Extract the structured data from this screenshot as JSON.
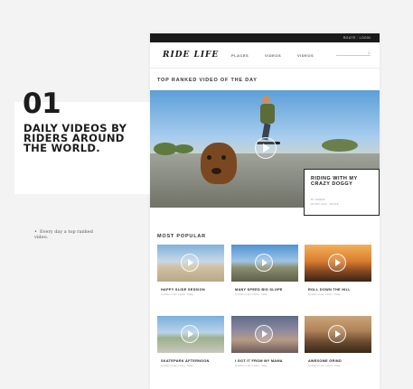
{
  "promo": {
    "number": "01",
    "tagline": "Daily videos by riders around the world.",
    "note": "Every day a top ranked video."
  },
  "site": {
    "topbar_links": "ROUTE · LOGIN",
    "logo": "RIDE LIFE",
    "nav": [
      "PLACES",
      "VIDEOS",
      "VIDEOS"
    ],
    "featured_heading": "TOP RANKED VIDEO OF THE DAY",
    "featured_video": {
      "title": "Riding with my crazy doggy",
      "meta_line1": "BY RIDERS",
      "meta_line2": "30 MAY 2014 · ROUTE"
    },
    "popular_heading": "MOST POPULAR",
    "videos": [
      {
        "title": "HAPPY SLIDE SESSION",
        "meta": "by Rider on Apr 1 2014 · Today"
      },
      {
        "title": "MANY SPEED BIG SLOPE",
        "meta": "by Rider on Apr 1 2014 · Today"
      },
      {
        "title": "ROLL DOWN THE HILL",
        "meta": "by Rider on Apr 1 2014 · Today"
      },
      {
        "title": "SKATEPARK AFTERNOON",
        "meta": "by Rider on Apr 1 2014 · Today"
      },
      {
        "title": "I GOT IT FROM MY MAMA",
        "meta": "by Rider on Apr 1 2014 · Today"
      },
      {
        "title": "AWESOME GRIND",
        "meta": "by Rider on Apr 1 2014 · Today"
      }
    ]
  }
}
